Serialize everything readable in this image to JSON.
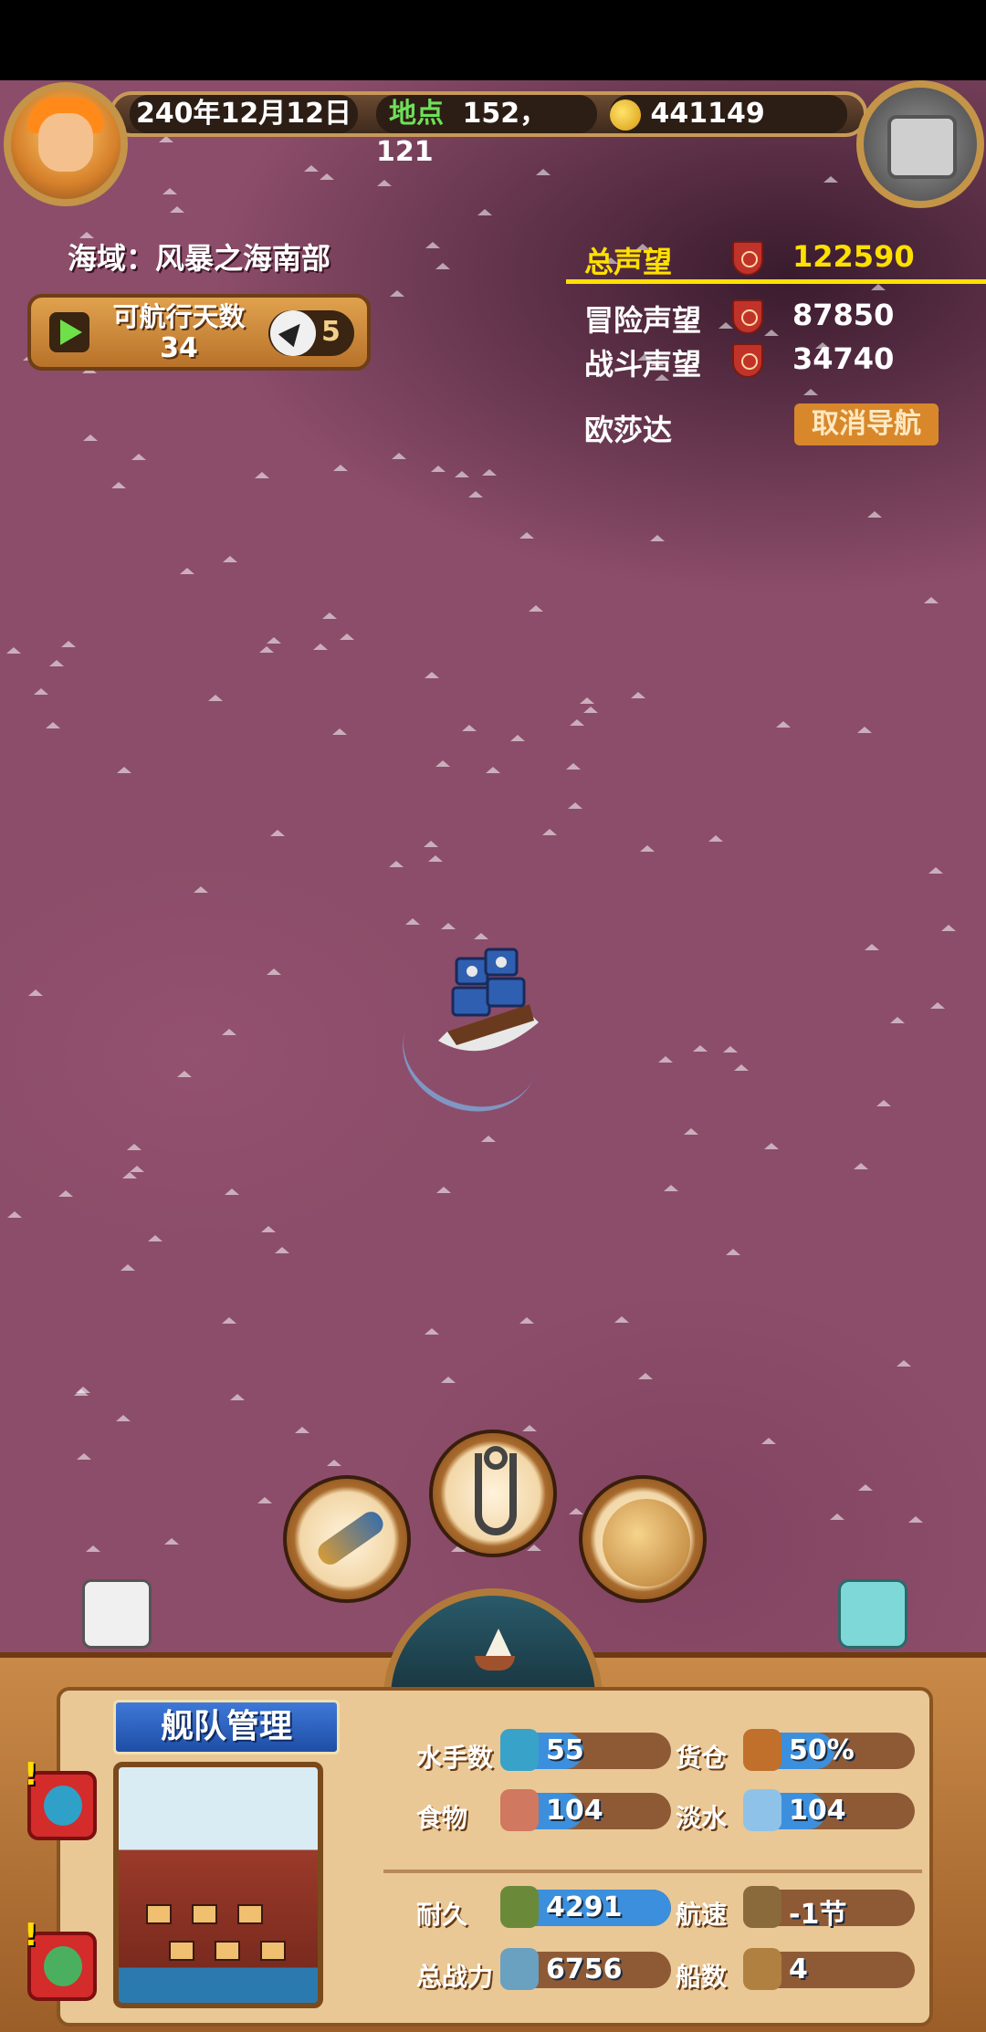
{
  "header": {
    "date": "240年12月12日",
    "location_label": "地点",
    "location_value": "152，121",
    "gold": "441149"
  },
  "region": {
    "text": "海域：风暴之海南部"
  },
  "sailing": {
    "label": "可航行天数",
    "days": "34",
    "speed": "5"
  },
  "reputation": {
    "total_label": "总声望",
    "total_value": "122590",
    "adventure_label": "冒险声望",
    "adventure_value": "87850",
    "combat_label": "战斗声望",
    "combat_value": "34740",
    "destination": "欧莎达",
    "cancel_button": "取消导航"
  },
  "actions": {
    "icons": [
      "spyglass-icon",
      "anchor-icon",
      "world-map-icon",
      "ship-icon"
    ]
  },
  "fleet": {
    "title": "舰队管理",
    "stats": [
      {
        "label": "水手数",
        "value": "55",
        "icon": "sailor-icon",
        "fill": 0.45
      },
      {
        "label": "货仓",
        "value": "50%",
        "icon": "cargo-crate-icon",
        "fill": 0.5
      },
      {
        "label": "食物",
        "value": "104",
        "icon": "meat-icon",
        "fill": 0.45
      },
      {
        "label": "淡水",
        "value": "104",
        "icon": "water-jug-icon",
        "fill": 0.45
      },
      {
        "label": "耐久",
        "value": "4291",
        "icon": "durability-ship-icon",
        "fill": 1.0
      },
      {
        "label": "航速",
        "value": "-1节",
        "icon": "speed-ship-icon",
        "fill": 0
      },
      {
        "label": "总战力",
        "value": "6756",
        "icon": "power-icon",
        "fill": 0
      },
      {
        "label": "船数",
        "value": "4",
        "icon": "ship-count-icon",
        "fill": 0
      }
    ]
  },
  "colors": {
    "sea": "#8c4d6a",
    "highlight_yellow": "#ffe000",
    "panel_wood": "#c98a48",
    "bar_fill": "#3c8fdc"
  }
}
